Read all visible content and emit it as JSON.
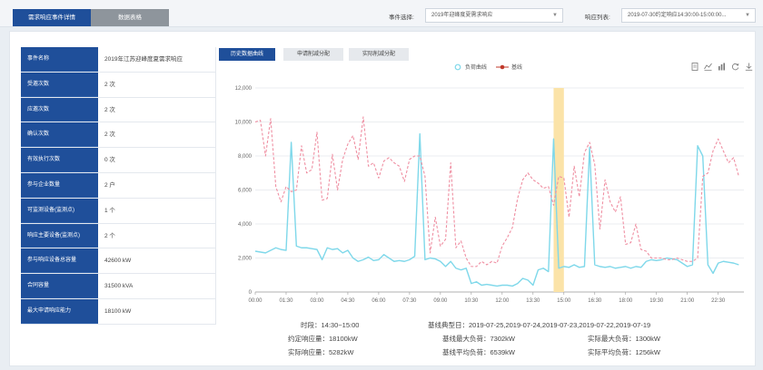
{
  "tabs": [
    {
      "label": "需求响应事件详情",
      "active": true
    },
    {
      "label": "数据表格",
      "active": false
    }
  ],
  "filters": {
    "event_label": "事件选择:",
    "event_value": "2019年迎峰度夏需求响应",
    "response_label": "响应列表:",
    "response_value": "2019-07-30约定响应14:30:00-15:00:00..."
  },
  "info_rows": [
    {
      "key": "事件名称",
      "value": "2019年江苏迎峰度夏需求响应"
    },
    {
      "key": "受邀次数",
      "value": "2 次"
    },
    {
      "key": "应邀次数",
      "value": "2 次"
    },
    {
      "key": "确认次数",
      "value": "2 次"
    },
    {
      "key": "有效执行次数",
      "value": "0 次"
    },
    {
      "key": "参与企业数量",
      "value": "2 户"
    },
    {
      "key": "可监测设备(监测点)",
      "value": "1 个"
    },
    {
      "key": "响应主要设备(监测点)",
      "value": "2 个"
    },
    {
      "key": "参与响应设备总容量",
      "value": "42600 kW"
    },
    {
      "key": "合同容量",
      "value": "31500 kVA"
    },
    {
      "key": "最大申请响应能力",
      "value": "18100 kW"
    }
  ],
  "chart_tabs": [
    {
      "label": "历史数据曲线",
      "active": true
    },
    {
      "label": "申请削减分配",
      "active": false
    },
    {
      "label": "实际削减分配",
      "active": false
    }
  ],
  "legend": {
    "load": "负荷曲线",
    "baseline": "基线"
  },
  "toolbox_icons": [
    "data-view-icon",
    "line-chart-icon",
    "bar-chart-icon",
    "refresh-icon",
    "download-icon"
  ],
  "colors": {
    "primary": "#1f4f9a",
    "load": "#7fd8ea",
    "baseline": "#ef8fa2",
    "highlight": "#fbe3a8"
  },
  "chart_data": {
    "type": "line",
    "x_ticks": [
      "00:00",
      "01:30",
      "03:00",
      "04:30",
      "06:00",
      "07:30",
      "09:00",
      "10:30",
      "12:00",
      "13:30",
      "15:00",
      "16:30",
      "18:00",
      "19:30",
      "21:00",
      "22:30"
    ],
    "ylim": [
      0,
      12000
    ],
    "y_ticks": [
      "0",
      "2,000",
      "4,000",
      "6,000",
      "8,000",
      "10,000",
      "12,000"
    ],
    "highlight_window": [
      "14:30",
      "15:00"
    ],
    "series": [
      {
        "name": "负荷曲线",
        "hours": [
          0,
          0.5,
          1,
          1.25,
          1.5,
          1.75,
          2,
          2.25,
          2.5,
          2.75,
          3,
          3.25,
          3.5,
          3.75,
          4,
          4.25,
          4.5,
          4.75,
          5,
          5.25,
          5.5,
          5.75,
          6,
          6.25,
          6.5,
          6.75,
          7,
          7.25,
          7.5,
          7.75,
          8,
          8.25,
          8.5,
          8.75,
          9,
          9.25,
          9.5,
          9.75,
          10,
          10.25,
          10.5,
          10.75,
          11,
          11.25,
          11.5,
          11.75,
          12,
          12.25,
          12.5,
          12.75,
          13,
          13.25,
          13.5,
          13.75,
          14,
          14.25,
          14.5,
          14.75,
          15,
          15.25,
          15.5,
          15.75,
          16,
          16.25,
          16.5,
          16.75,
          17,
          17.25,
          17.5,
          17.75,
          18,
          18.25,
          18.5,
          18.75,
          19,
          19.25,
          19.5,
          19.75,
          20,
          20.25,
          20.5,
          20.75,
          21,
          21.25,
          21.5,
          21.75,
          22,
          22.25,
          22.5,
          22.75,
          23,
          23.25,
          23.5
        ],
        "values": [
          2400,
          2300,
          2600,
          2500,
          2450,
          8800,
          2700,
          2600,
          2600,
          2550,
          2500,
          1900,
          2600,
          2500,
          2550,
          2300,
          2450,
          2000,
          1800,
          1900,
          2050,
          1850,
          1900,
          2200,
          2000,
          1800,
          1850,
          1800,
          1900,
          2100,
          9300,
          1900,
          2000,
          1950,
          1800,
          1500,
          1800,
          1400,
          1300,
          1400,
          500,
          600,
          400,
          450,
          400,
          350,
          400,
          400,
          350,
          500,
          800,
          700,
          400,
          1300,
          1400,
          1200,
          9000,
          1400,
          1500,
          1450,
          1600,
          1450,
          1500,
          8500,
          1600,
          1500,
          1450,
          1500,
          1400,
          1450,
          1500,
          1400,
          1500,
          1450,
          1800,
          1900,
          1850,
          1900,
          2000,
          1950,
          1900,
          1700,
          1500,
          1600,
          8600,
          8000,
          1600,
          1100,
          1700,
          1800,
          1750,
          1700,
          1600
        ]
      },
      {
        "name": "基线",
        "hours": [
          0,
          0.25,
          0.5,
          0.75,
          1,
          1.25,
          1.5,
          1.75,
          2,
          2.25,
          2.5,
          2.75,
          3,
          3.25,
          3.5,
          3.75,
          4,
          4.25,
          4.5,
          4.75,
          5,
          5.25,
          5.5,
          5.75,
          6,
          6.25,
          6.5,
          6.75,
          7,
          7.25,
          7.5,
          7.75,
          8,
          8.25,
          8.5,
          8.75,
          9,
          9.25,
          9.5,
          9.75,
          10,
          10.25,
          10.5,
          10.75,
          11,
          11.25,
          11.5,
          11.75,
          12,
          12.25,
          12.5,
          12.75,
          13,
          13.25,
          13.5,
          13.75,
          14,
          14.25,
          14.5,
          14.75,
          15,
          15.25,
          15.5,
          15.75,
          16,
          16.25,
          16.5,
          16.75,
          17,
          17.25,
          17.5,
          17.75,
          18,
          18.25,
          18.5,
          18.75,
          19,
          19.25,
          19.5,
          19.75,
          20,
          20.25,
          20.5,
          20.75,
          21,
          21.25,
          21.5,
          21.75,
          22,
          22.25,
          22.5,
          22.75,
          23,
          23.25,
          23.5
        ],
        "values": [
          10000,
          10100,
          8000,
          10200,
          6200,
          5300,
          6200,
          5900,
          6000,
          8600,
          7000,
          7200,
          9400,
          5400,
          5500,
          8100,
          6000,
          7800,
          8700,
          9200,
          7800,
          10300,
          7400,
          7600,
          6700,
          7700,
          7900,
          7600,
          7400,
          6500,
          7800,
          8000,
          8000,
          6800,
          2300,
          4400,
          2700,
          3100,
          7600,
          2600,
          3000,
          2000,
          1500,
          1500,
          1800,
          1600,
          1800,
          1700,
          2700,
          3200,
          3800,
          5500,
          6600,
          7000,
          6600,
          6400,
          6100,
          6200,
          5100,
          6800,
          6700,
          4400,
          7400,
          5600,
          8200,
          8800,
          7500,
          3700,
          6600,
          5300,
          4700,
          5600,
          2800,
          2900,
          4000,
          2500,
          2400,
          2000,
          2000,
          2000,
          1900,
          1900,
          2000,
          1900,
          1800,
          1800,
          2000,
          6800,
          7000,
          8300,
          9000,
          8300,
          7600,
          7900,
          6800,
          6500
        ]
      }
    ]
  },
  "stats": {
    "period": "时段：14:30~15:00",
    "typical_days": "基线典型日：2019-07-25,2019-07-24,2019-07-23,2019-07-22,2019-07-19",
    "agreed": "约定响应量：18100kW",
    "baseline_max": "基线最大负荷：7302kW",
    "actual_max": "实际最大负荷：1300kW",
    "actual_response": "实际响应量：5282kW",
    "baseline_avg": "基线平均负荷：6539kW",
    "actual_avg": "实际平均负荷：1256kW"
  }
}
